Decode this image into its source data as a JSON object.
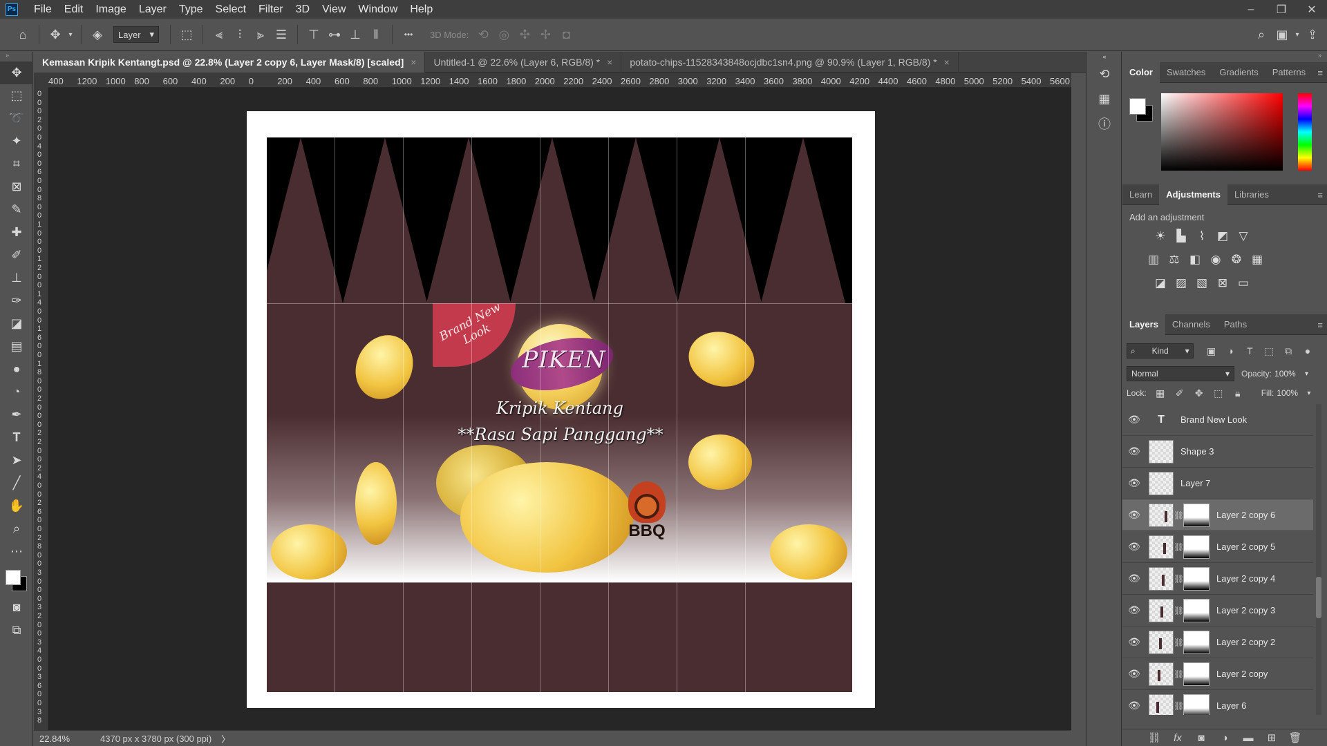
{
  "app": {
    "logo_text": "Ps"
  },
  "menu": [
    "File",
    "Edit",
    "Image",
    "Layer",
    "Type",
    "Select",
    "Filter",
    "3D",
    "View",
    "Window",
    "Help"
  ],
  "window_controls": {
    "minimize": "–",
    "restore": "❐",
    "close": "✕"
  },
  "options_bar": {
    "auto_select_target": "Layer",
    "mode_3d_label": "3D Mode:",
    "more_glyph": "•••"
  },
  "tabs": [
    {
      "label": "Kemasan Kripik Kentangt.psd @ 22.8% (Layer 2 copy 6, Layer Mask/8) [scaled]",
      "close": "×"
    },
    {
      "label": "Untitled-1 @ 22.6% (Layer 6, RGB/8) *",
      "close": "×"
    },
    {
      "label": "potato-chips-11528343848ocjdbc1sn4.png @ 90.9% (Layer 1, RGB/8) *",
      "close": "×"
    }
  ],
  "ruler_h": [
    "400",
    "1200",
    "1000",
    "800",
    "600",
    "400",
    "200",
    "0",
    "200",
    "400",
    "600",
    "800",
    "1000",
    "1200",
    "1400",
    "1600",
    "1800",
    "2000",
    "2200",
    "2400",
    "2600",
    "2800",
    "3000",
    "3200",
    "3400",
    "3600",
    "3800",
    "4000",
    "4200",
    "4400",
    "4600",
    "4800",
    "5000",
    "5200",
    "5400",
    "5600"
  ],
  "ruler_v": [
    "0",
    "0",
    "0",
    "2",
    "0",
    "0",
    "4",
    "0",
    "0",
    "6",
    "0",
    "0",
    "8",
    "0",
    "0",
    "1",
    "0",
    "0",
    "0",
    "1",
    "2",
    "0",
    "0",
    "1",
    "4",
    "0",
    "0",
    "1",
    "6",
    "0",
    "0",
    "1",
    "8",
    "0",
    "0",
    "2",
    "0",
    "0",
    "0",
    "2",
    "2",
    "0",
    "0",
    "2",
    "4",
    "0",
    "0",
    "2",
    "6",
    "0",
    "0",
    "2",
    "8",
    "0",
    "0",
    "3",
    "0",
    "0",
    "0",
    "3",
    "2",
    "0",
    "0",
    "3",
    "4",
    "0",
    "0",
    "3",
    "6",
    "0",
    "0",
    "3",
    "8"
  ],
  "design": {
    "badge_text": "Brand New Look",
    "brand_name": "PIKEN",
    "product_name": "Kripik Kentang",
    "flavor_name": "**Rasa Sapi Panggang**",
    "bbq_text": "BBQ"
  },
  "status": {
    "zoom": "22.84%",
    "doc_size": "4370 px x 3780 px (300 ppi)",
    "arrow": "〉"
  },
  "panels": {
    "color_tabs": [
      "Color",
      "Swatches",
      "Gradients",
      "Patterns"
    ],
    "adjust_tabs": [
      "Learn",
      "Adjustments",
      "Libraries"
    ],
    "adjust_hint": "Add an adjustment",
    "layers_tabs": [
      "Layers",
      "Channels",
      "Paths"
    ],
    "kind_label": "Kind",
    "blend_mode": "Normal",
    "opacity_label": "Opacity:",
    "opacity_value": "100%",
    "lock_label": "Lock:",
    "fill_label": "Fill:",
    "fill_value": "100%"
  },
  "layers": [
    {
      "name": "Brand  New  Look",
      "type": "text",
      "visible": true,
      "selected": false,
      "mask": false
    },
    {
      "name": "Shape 3",
      "type": "shape",
      "visible": true,
      "selected": false,
      "mask": false
    },
    {
      "name": "Layer 7",
      "type": "pixel",
      "visible": true,
      "selected": false,
      "mask": false
    },
    {
      "name": "Layer 2 copy 6",
      "type": "pixel",
      "visible": true,
      "selected": true,
      "mask": true
    },
    {
      "name": "Layer 2 copy 5",
      "type": "pixel",
      "visible": true,
      "selected": false,
      "mask": true
    },
    {
      "name": "Layer 2 copy 4",
      "type": "pixel",
      "visible": true,
      "selected": false,
      "mask": true
    },
    {
      "name": "Layer 2 copy 3",
      "type": "pixel",
      "visible": true,
      "selected": false,
      "mask": true
    },
    {
      "name": "Layer 2 copy 2",
      "type": "pixel",
      "visible": true,
      "selected": false,
      "mask": true
    },
    {
      "name": "Layer 2 copy",
      "type": "pixel",
      "visible": true,
      "selected": false,
      "mask": true
    },
    {
      "name": "Layer 6",
      "type": "pixel",
      "visible": true,
      "selected": false,
      "mask": true
    }
  ],
  "colors": {
    "foreground": "#ffffff",
    "background": "#000000",
    "package_base": "#4a2d31",
    "badge": "#c23a4b"
  }
}
